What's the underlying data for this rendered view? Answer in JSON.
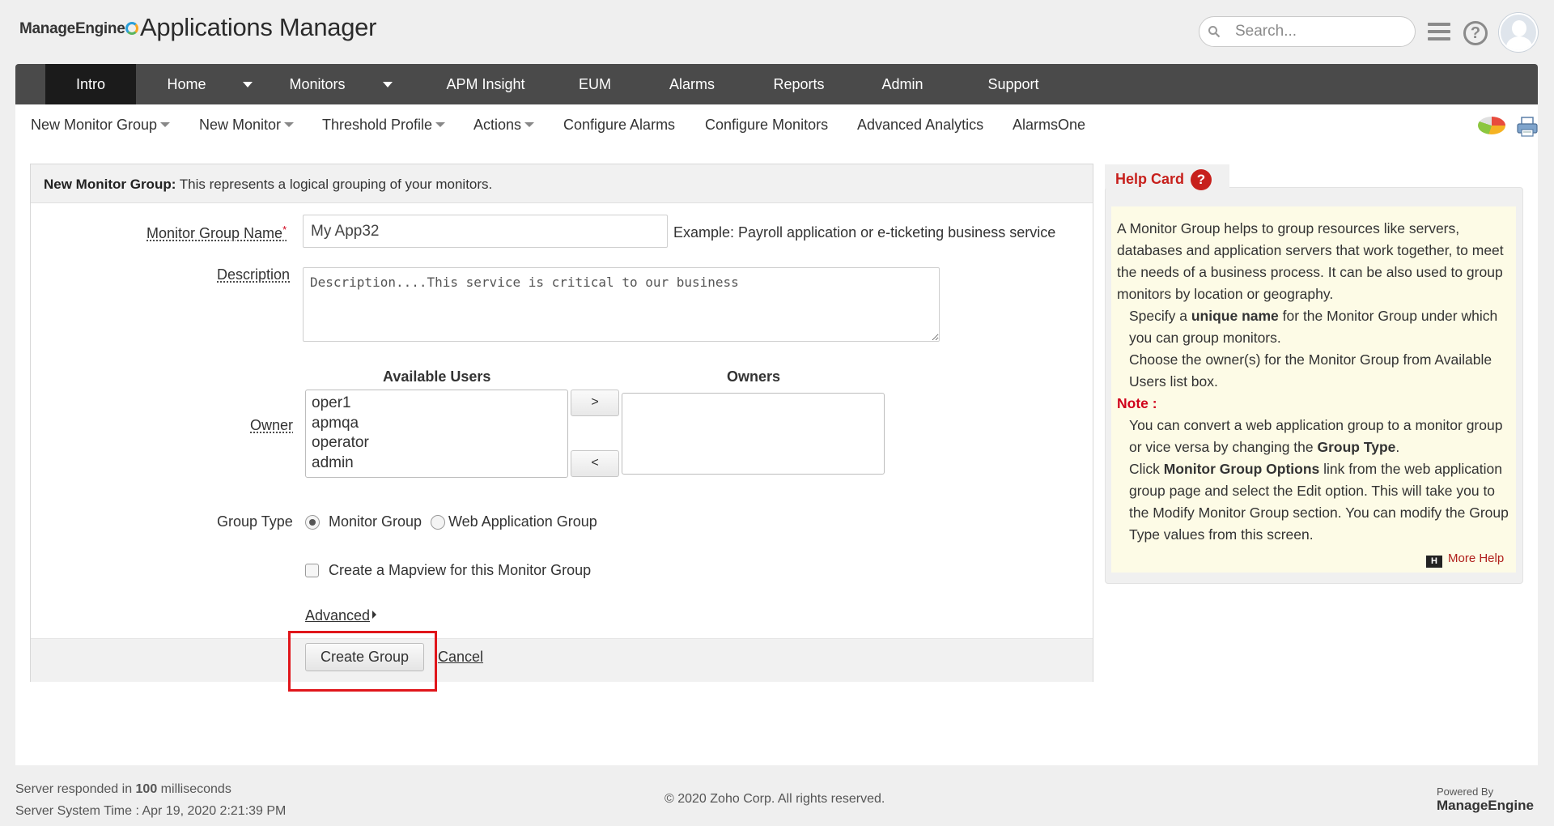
{
  "header": {
    "brand": "ManageEngine",
    "product": "Applications Manager",
    "search_placeholder": "Search..."
  },
  "main_nav": {
    "items": [
      {
        "label": "Intro",
        "active": true
      },
      {
        "label": "Home",
        "has_dropdown": true
      },
      {
        "label": "Monitors",
        "has_dropdown": true
      },
      {
        "label": "APM Insight"
      },
      {
        "label": "EUM"
      },
      {
        "label": "Alarms"
      },
      {
        "label": "Reports"
      },
      {
        "label": "Admin"
      },
      {
        "label": "Support"
      }
    ]
  },
  "sub_nav": {
    "items": [
      {
        "label": "New Monitor Group",
        "has_dropdown": true
      },
      {
        "label": "New Monitor",
        "has_dropdown": true
      },
      {
        "label": "Threshold Profile",
        "has_dropdown": true
      },
      {
        "label": "Actions",
        "has_dropdown": true
      },
      {
        "label": "Configure Alarms"
      },
      {
        "label": "Configure Monitors"
      },
      {
        "label": "Advanced Analytics"
      },
      {
        "label": "AlarmsOne"
      }
    ]
  },
  "form": {
    "title_bold": "New Monitor Group:",
    "title_rest": " This represents a logical grouping of your monitors.",
    "name_label": "Monitor Group Name",
    "required_mark": "*",
    "name_value": "My App32",
    "name_example": "Example: Payroll application or e-ticketing business service",
    "description_label": "Description",
    "description_value": "Description....This service is critical to our business",
    "available_users_header": "Available Users",
    "owners_header": "Owners",
    "owner_label": "Owner",
    "available_users": [
      "oper1",
      "apmqa",
      "operator",
      "admin"
    ],
    "owners": [],
    "move_right_label": ">",
    "move_left_label": "<",
    "group_type_label": "Group Type",
    "group_type_options": [
      {
        "label": "Monitor Group",
        "selected": true
      },
      {
        "label": "Web Application Group",
        "selected": false
      }
    ],
    "mapview_label": "Create a Mapview for this Monitor Group",
    "mapview_checked": false,
    "advanced_label": "Advanced",
    "create_button": "Create Group",
    "cancel_link": "Cancel"
  },
  "help_card": {
    "title": "Help Card",
    "qmark": "?",
    "para1": "A Monitor Group helps to group resources like servers, databases and application servers that work together, to meet the needs of a business process. It can be also used to group monitors by location or geography.",
    "item1_pre": "Specify a ",
    "item1_bold": "unique name",
    "item1_post": " for the Monitor Group under which you can group monitors.",
    "item2": "Choose the owner(s) for the Monitor Group from Available Users list box.",
    "note_label": "Note :",
    "note1_pre": "You can convert a web application group to a monitor group or vice versa by changing the ",
    "note1_bold": "Group Type",
    "note1_post": ".",
    "note2_pre": "Click ",
    "note2_bold": "Monitor Group Options",
    "note2_post": " link from the web application group page and select the Edit option. This will take you to the Modify Monitor Group section. You can modify the Group Type values from this screen.",
    "more_help": "More Help",
    "more_help_icon": "H"
  },
  "footer": {
    "response_pre": "Server responded in ",
    "response_ms": "100",
    "response_post": " milliseconds",
    "server_time": "Server System Time : Apr 19, 2020 2:21:39 PM",
    "copyright": "© 2020 Zoho Corp.   All rights reserved.",
    "powered_by": "Powered By",
    "powered_brand": "ManageEngine"
  },
  "colors": {
    "nav_bg": "#4a4a4a",
    "nav_active": "#1b1b1b",
    "help_red": "#c7201c",
    "highlight": "#e0161b",
    "help_bg": "#fdfbe6"
  }
}
